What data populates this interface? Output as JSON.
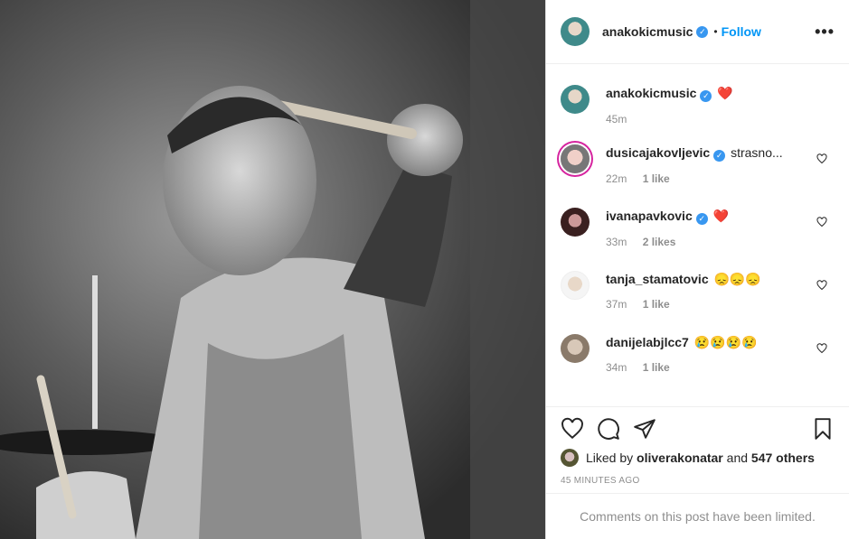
{
  "header": {
    "username": "anakokicmusic",
    "verified_mark": "✓",
    "separator": "•",
    "follow_label": "Follow",
    "more_label": "•••"
  },
  "caption": {
    "username": "anakokicmusic",
    "verified_mark": "✓",
    "text": "❤️",
    "time": "45m"
  },
  "comments": [
    {
      "username": "dusicajakovljevic",
      "verified": true,
      "verified_mark": "✓",
      "text": "strasno...",
      "time": "22m",
      "likes": "1 like"
    },
    {
      "username": "ivanapavkovic",
      "verified": true,
      "verified_mark": "✓",
      "text": "❤️",
      "time": "33m",
      "likes": "2 likes"
    },
    {
      "username": "tanja_stamatovic",
      "verified": false,
      "text": "😞😞😞",
      "time": "37m",
      "likes": "1 like"
    },
    {
      "username": "danijelabjlcc7",
      "verified": false,
      "text": "😢😢😢😢",
      "time": "34m",
      "likes": "1 like"
    }
  ],
  "actions": {
    "icons": [
      "heart-icon",
      "comment-icon",
      "share-icon",
      "bookmark-icon"
    ]
  },
  "likes": {
    "prefix": "Liked by",
    "user": "oliverakonatar",
    "middle": "and",
    "others": "547 others"
  },
  "time_ago": "45 MINUTES AGO",
  "comments_limited": "Comments on this post have been limited.",
  "colors": {
    "follow": "#0095f6",
    "verified": "#3897f0",
    "heart": "#ed4956",
    "muted": "#8e8e8e"
  }
}
